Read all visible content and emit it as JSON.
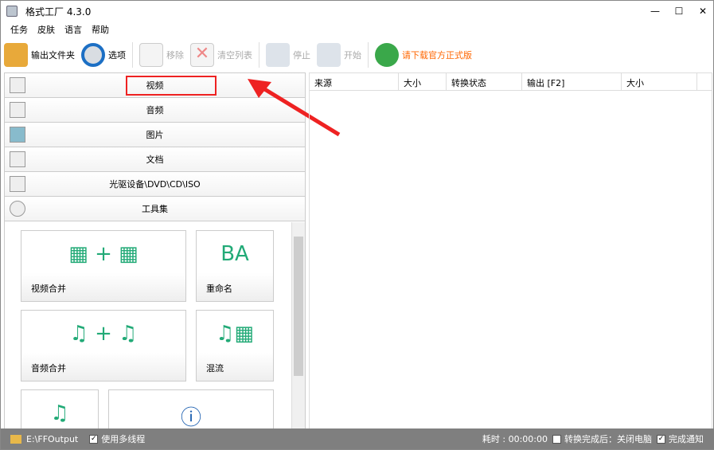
{
  "window": {
    "title": "格式工厂 4.3.0",
    "minimize": "—",
    "maximize": "☐",
    "close": "✕"
  },
  "menu": [
    "任务",
    "皮肤",
    "语言",
    "帮助"
  ],
  "toolbar": {
    "output_folder": "输出文件夹",
    "options": "选项",
    "remove": "移除",
    "clear": "清空列表",
    "stop": "停止",
    "start": "开始",
    "download": "请下载官方正式版",
    "download_color": "#ff6600"
  },
  "categories": [
    "视频",
    "音频",
    "图片",
    "文档",
    "光驱设备\\DVD\\CD\\ISO",
    "工具集"
  ],
  "tools": [
    "视频合并",
    "重命名",
    "音频合并",
    "混流"
  ],
  "table": {
    "columns": [
      "来源",
      "大小",
      "转换状态",
      "输出 [F2]",
      "大小"
    ]
  },
  "status": {
    "path": "E:\\FFOutput",
    "multithread": "使用多线程",
    "elapsed": "耗时 : 00:00:00",
    "shutdown": "转换完成后：关闭电脑",
    "notify": "完成通知"
  }
}
